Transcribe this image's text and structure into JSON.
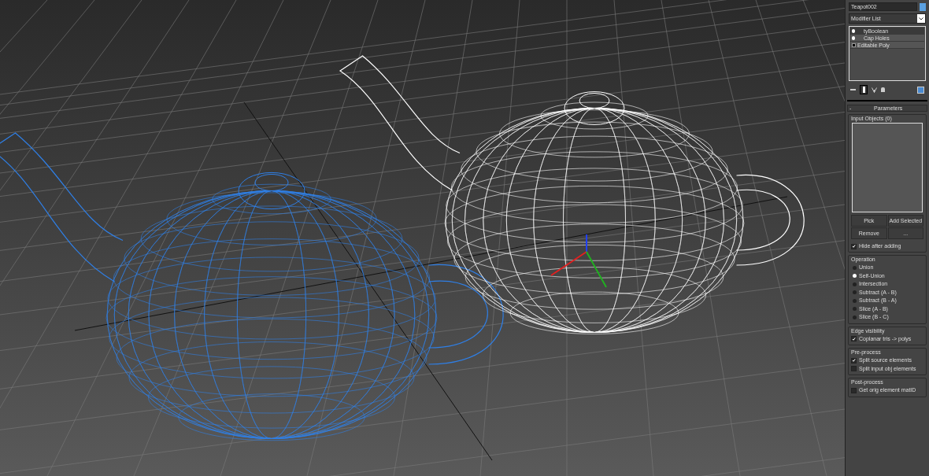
{
  "object_name": "Teapot002",
  "modifier_list": {
    "label": "Modifier List"
  },
  "stack": [
    {
      "label": "tyBoolean",
      "kind": "modifier",
      "selected": true
    },
    {
      "label": "Cap Holes",
      "kind": "modifier",
      "selected": false
    },
    {
      "label": "Editable Poly",
      "kind": "base",
      "selected": false
    }
  ],
  "rollout": {
    "collapse": "-",
    "title": "Parameters"
  },
  "input_objects": {
    "title": "Input Objects (0)",
    "buttons": [
      "Pick",
      "Add Selected",
      "Remove",
      "..."
    ],
    "hide_after_adding": {
      "label": "Hide after adding",
      "checked": true
    }
  },
  "operation": {
    "title": "Operation",
    "options": [
      {
        "label": "Union",
        "selected": false
      },
      {
        "label": "Self-Union",
        "selected": true
      },
      {
        "label": "Intersection",
        "selected": false
      },
      {
        "label": "Subtract (A - B)",
        "selected": false
      },
      {
        "label": "Subtract (B - A)",
        "selected": false
      },
      {
        "label": "Slice (A - B)",
        "selected": false
      },
      {
        "label": "Slice (B - C)",
        "selected": false
      }
    ]
  },
  "groups": [
    {
      "title": "Edge visibility",
      "options": [
        {
          "label": "Coplanar tris -> polys",
          "checked": true
        }
      ]
    },
    {
      "title": "Pre-process",
      "options": [
        {
          "label": "Split source elements",
          "checked": true
        },
        {
          "label": "Split input obj elements",
          "checked": false
        }
      ]
    },
    {
      "title": "Post-process",
      "options": [
        {
          "label": "Get orig element matID",
          "checked": false
        }
      ]
    }
  ]
}
